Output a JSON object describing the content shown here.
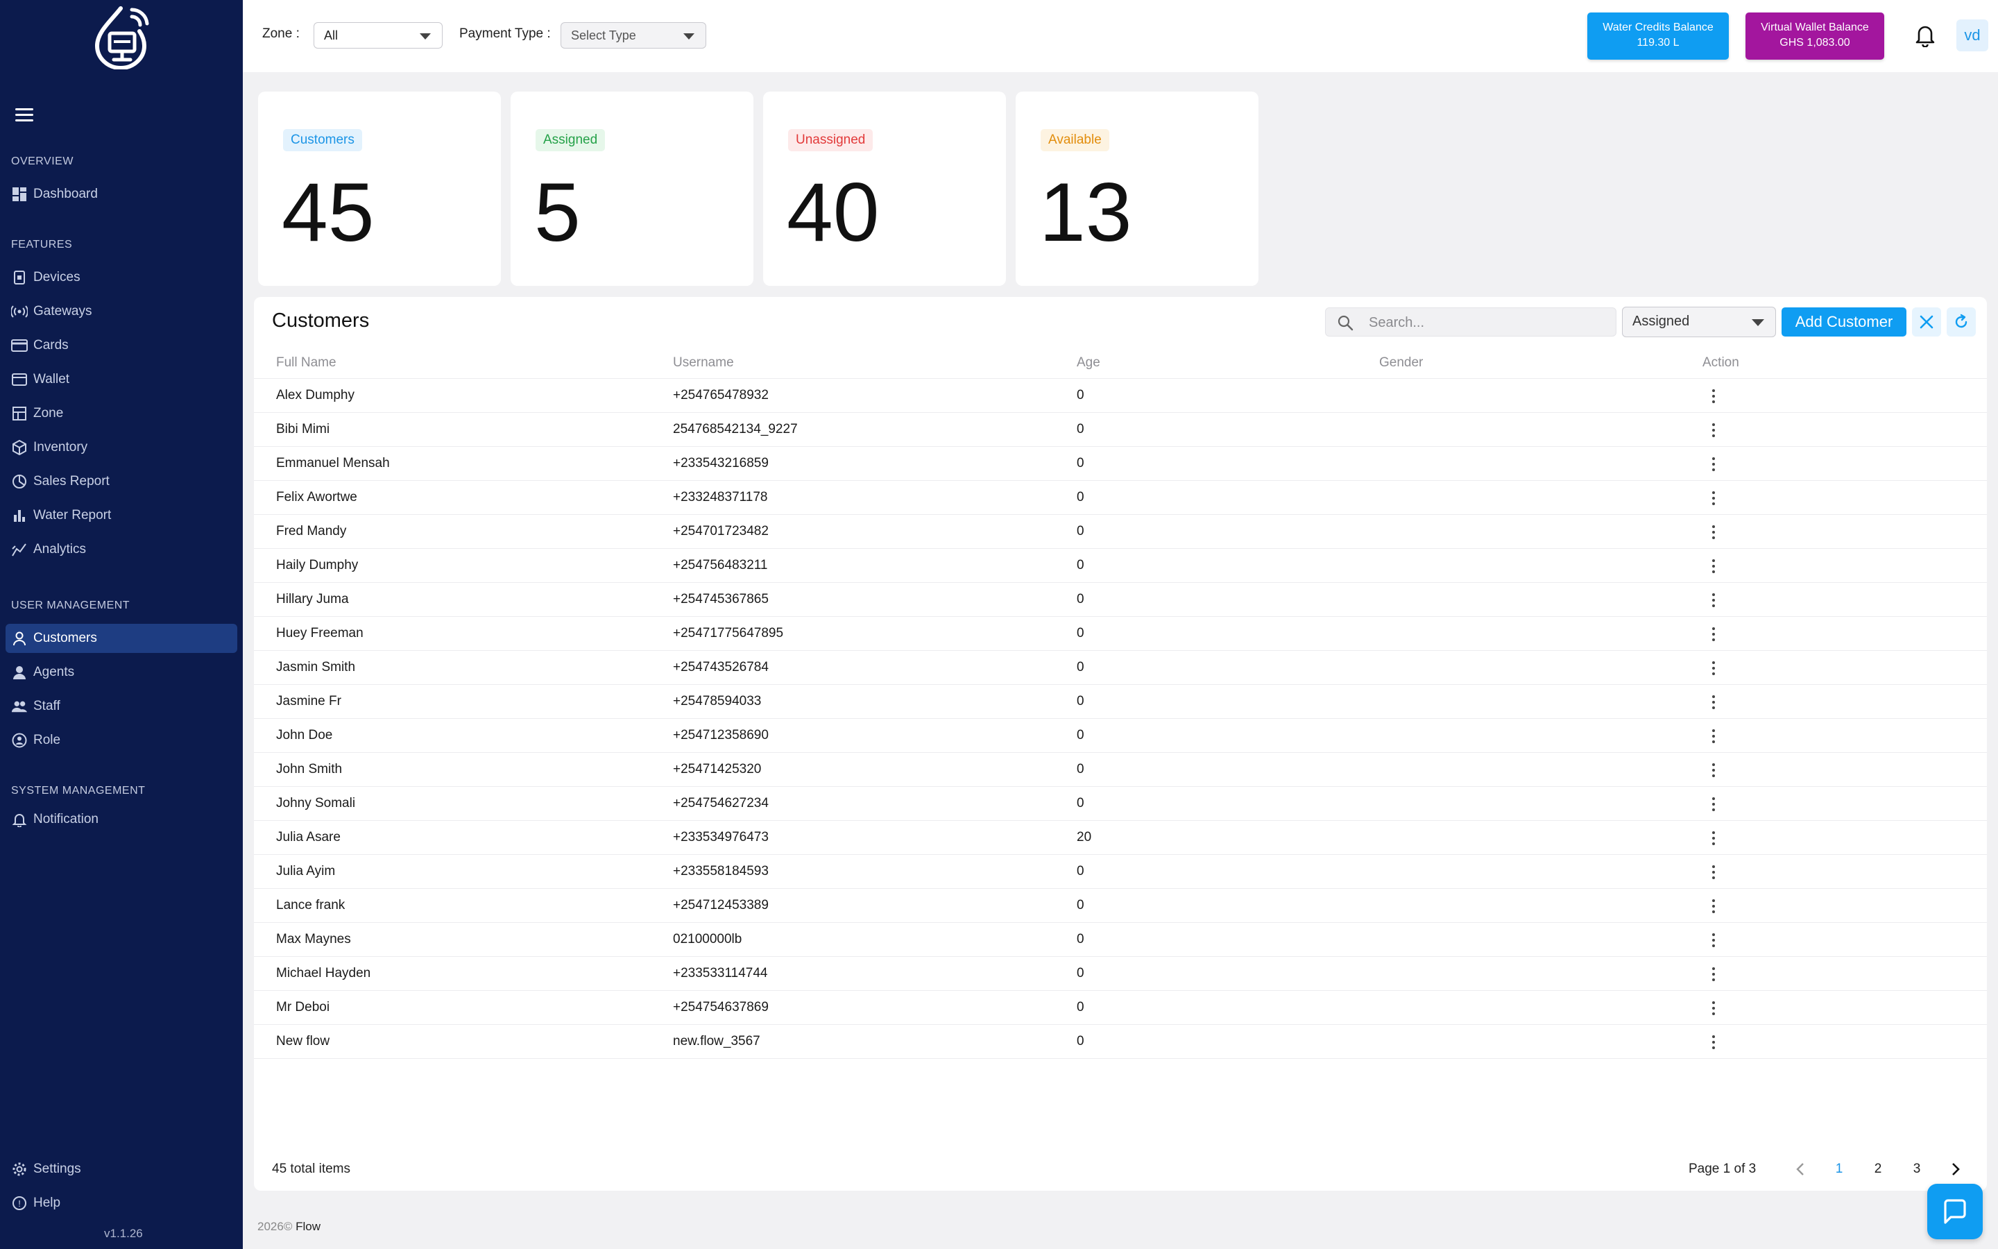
{
  "topbar": {
    "zone_label": "Zone :",
    "zone_value": "All",
    "payment_label": "Payment Type :",
    "payment_placeholder": "Select Type",
    "water_credits": {
      "title": "Water Credits Balance",
      "value": "119.30 L",
      "color": "#0f9df2"
    },
    "virtual_wallet": {
      "title": "Virtual Wallet Balance",
      "value": "GHS 1,083.00",
      "color": "#a3169e"
    },
    "avatar_initials": "vd"
  },
  "sidebar": {
    "sections": [
      {
        "label": "OVERVIEW",
        "items": [
          {
            "label": "Dashboard",
            "icon": "dashboard-icon"
          }
        ]
      },
      {
        "label": "FEATURES",
        "items": [
          {
            "label": "Devices",
            "icon": "device-icon"
          },
          {
            "label": "Gateways",
            "icon": "gateway-icon"
          },
          {
            "label": "Cards",
            "icon": "card-icon"
          },
          {
            "label": "Wallet",
            "icon": "wallet-icon"
          },
          {
            "label": "Zone",
            "icon": "zone-icon"
          },
          {
            "label": "Inventory",
            "icon": "inventory-icon"
          },
          {
            "label": "Sales Report",
            "icon": "sales-report-icon"
          },
          {
            "label": "Water Report",
            "icon": "bar-chart-icon"
          },
          {
            "label": "Analytics",
            "icon": "analytics-icon"
          }
        ]
      },
      {
        "label": "USER MANAGEMENT",
        "items": [
          {
            "label": "Customers",
            "icon": "user-icon",
            "active": true
          },
          {
            "label": "Agents",
            "icon": "agent-icon"
          },
          {
            "label": "Staff",
            "icon": "staff-icon"
          },
          {
            "label": "Role",
            "icon": "role-icon"
          }
        ]
      },
      {
        "label": "SYSTEM MANAGEMENT",
        "items": [
          {
            "label": "Notification",
            "icon": "bell-icon"
          }
        ]
      }
    ],
    "bottom": [
      {
        "label": "Settings",
        "icon": "gear-icon"
      },
      {
        "label": "Help",
        "icon": "help-icon"
      }
    ],
    "version": "v1.1.26"
  },
  "stats": [
    {
      "label": "Customers",
      "value": "45",
      "color": "#1c95e6",
      "bg": "#e3f2fd"
    },
    {
      "label": "Assigned",
      "value": "5",
      "color": "#24a148",
      "bg": "#e6f7ea"
    },
    {
      "label": "Unassigned",
      "value": "40",
      "color": "#e23a3a",
      "bg": "#fdeaea"
    },
    {
      "label": "Available",
      "value": "13",
      "color": "#e28d0c",
      "bg": "#fdf3e1"
    }
  ],
  "customers": {
    "title": "Customers",
    "search_placeholder": "Search...",
    "status_filter": "Assigned",
    "add_label": "Add Customer",
    "columns": [
      "Full Name",
      "Username",
      "Age",
      "Gender",
      "Action"
    ],
    "rows": [
      {
        "name": "Alex Dumphy",
        "username": "+254765478932",
        "age": "0",
        "gender": ""
      },
      {
        "name": "Bibi Mimi",
        "username": "254768542134_9227",
        "age": "0",
        "gender": ""
      },
      {
        "name": "Emmanuel Mensah",
        "username": "+233543216859",
        "age": "0",
        "gender": ""
      },
      {
        "name": "Felix  Awortwe",
        "username": "+233248371178",
        "age": "0",
        "gender": ""
      },
      {
        "name": "Fred Mandy",
        "username": "+254701723482",
        "age": "0",
        "gender": ""
      },
      {
        "name": "Haily Dumphy",
        "username": "+254756483211",
        "age": "0",
        "gender": ""
      },
      {
        "name": "Hillary Juma",
        "username": "+254745367865",
        "age": "0",
        "gender": ""
      },
      {
        "name": "Huey Freeman",
        "username": "+25471775647895",
        "age": "0",
        "gender": ""
      },
      {
        "name": "Jasmin Smith",
        "username": "+254743526784",
        "age": "0",
        "gender": ""
      },
      {
        "name": "Jasmine Fr",
        "username": "+25478594033",
        "age": "0",
        "gender": ""
      },
      {
        "name": "John Doe",
        "username": "+254712358690",
        "age": "0",
        "gender": ""
      },
      {
        "name": "John Smith",
        "username": "+25471425320",
        "age": "0",
        "gender": ""
      },
      {
        "name": "Johny Somali",
        "username": "+254754627234",
        "age": "0",
        "gender": ""
      },
      {
        "name": "Julia Asare",
        "username": "+233534976473",
        "age": "20",
        "gender": ""
      },
      {
        "name": "Julia Ayim",
        "username": "+233558184593",
        "age": "0",
        "gender": ""
      },
      {
        "name": "Lance frank",
        "username": "+254712453389",
        "age": "0",
        "gender": ""
      },
      {
        "name": "Max Maynes",
        "username": "02100000lb",
        "age": "0",
        "gender": ""
      },
      {
        "name": "Michael Hayden",
        "username": "+233533114744",
        "age": "0",
        "gender": ""
      },
      {
        "name": "Mr Deboi",
        "username": "+254754637869",
        "age": "0",
        "gender": ""
      },
      {
        "name": "New flow",
        "username": "new.flow_3567",
        "age": "0",
        "gender": ""
      }
    ],
    "total_text": "45 total items",
    "page_text": "Page 1 of 3",
    "pages": [
      "1",
      "2",
      "3"
    ],
    "current_page": "1"
  },
  "footer": {
    "year": "2026©",
    "brand": "Flow"
  }
}
